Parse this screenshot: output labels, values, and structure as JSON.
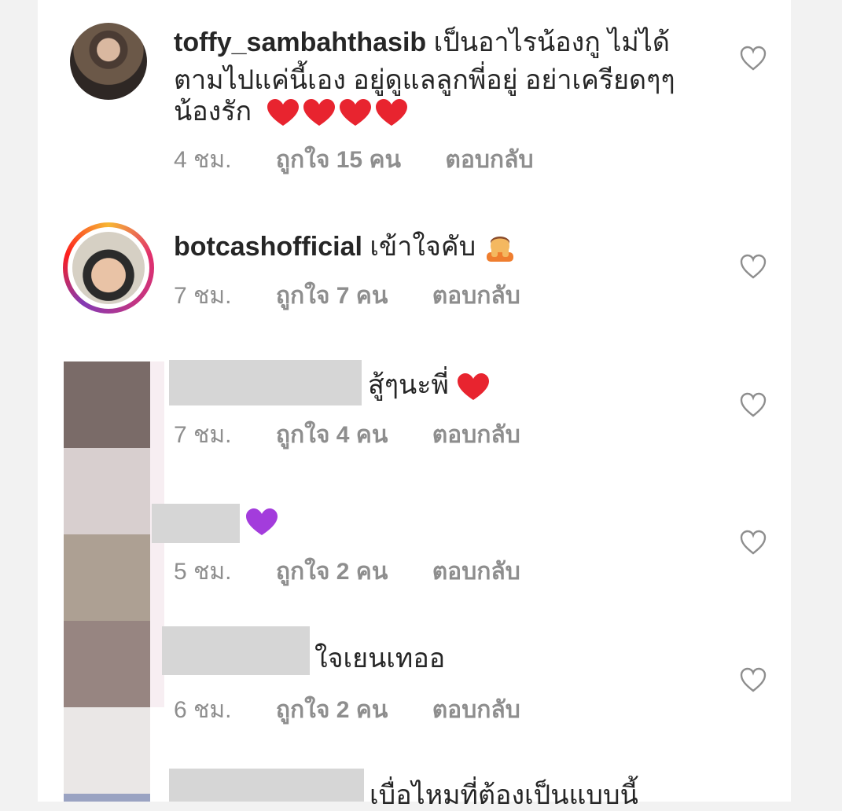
{
  "comments": [
    {
      "username": "toffy_sambahthasib",
      "text_line1": "เป็นอาไรน้องกู ไม่ได้",
      "text_line2": "ตามไปแค่นี้เอง อยู่ดูแลลูกพี่อยู่ อย่าเครียดๆๆ",
      "text_line3": "น้องรัก",
      "time": "4 ชม.",
      "likes": "ถูกใจ 15 คน",
      "reply": "ตอบกลับ"
    },
    {
      "username": "botcashofficial",
      "text": "เข้าใจคับ",
      "time": "7 ชม.",
      "likes": "ถูกใจ 7 คน",
      "reply": "ตอบกลับ"
    },
    {
      "text": "สู้ๆนะพี่",
      "time": "7 ชม.",
      "likes": "ถูกใจ 4 คน",
      "reply": "ตอบกลับ"
    },
    {
      "time": "5 ชม.",
      "likes": "ถูกใจ 2 คน",
      "reply": "ตอบกลับ"
    },
    {
      "text": "ใจเยนเทออ",
      "time": "6 ชม.",
      "likes": "ถูกใจ 2 คน",
      "reply": "ตอบกลับ"
    },
    {
      "text": "เบื่อไหมที่ต้องเป็นแบบนี้"
    }
  ],
  "icons": {
    "like": "heart-outline-icon",
    "red_heart": "red-heart-emoji",
    "purple_heart": "purple-heart-emoji",
    "face": "face-in-hands-emoji"
  },
  "colors": {
    "text": "#262626",
    "meta": "#8e8e8e",
    "red_heart": "#e8242f",
    "purple_heart": "#a33cdc",
    "heart_outline": "#8e8e8e"
  }
}
